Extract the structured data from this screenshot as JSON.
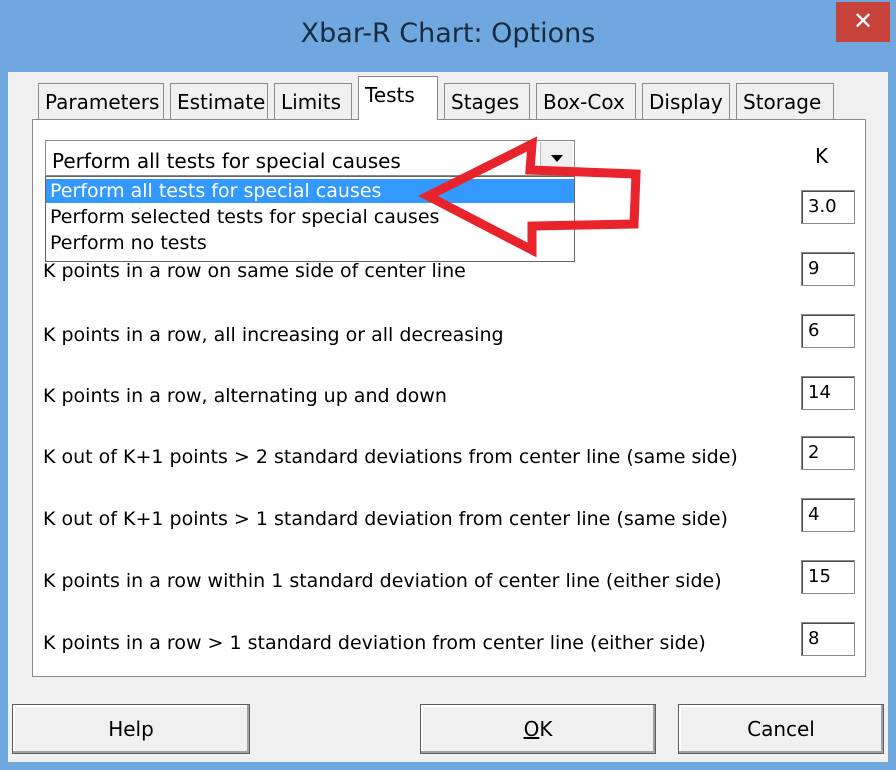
{
  "window": {
    "title": "Xbar-R Chart: Options",
    "close_glyph": "✕"
  },
  "tabs": [
    {
      "label": "Parameters",
      "active": false
    },
    {
      "label": "Estimate",
      "active": false
    },
    {
      "label": "Limits",
      "active": false
    },
    {
      "label": "Tests",
      "active": true
    },
    {
      "label": "Stages",
      "active": false
    },
    {
      "label": "Box-Cox",
      "active": false
    },
    {
      "label": "Display",
      "active": false
    },
    {
      "label": "Storage",
      "active": false
    }
  ],
  "tests": {
    "combo_value": "Perform all tests for special causes",
    "k_header": "K",
    "dropdown_options": [
      "Perform all tests for special causes",
      "Perform selected tests for special causes",
      "Perform no tests"
    ],
    "rows": [
      {
        "label": "",
        "k": "3.0"
      },
      {
        "label": "K points in a row on same side of center line",
        "k": "9"
      },
      {
        "label": "K points in a row, all increasing or all decreasing",
        "k": "6"
      },
      {
        "label": "K points in a row, alternating up and down",
        "k": "14"
      },
      {
        "label": "K out of K+1 points > 2 standard deviations from center line (same side)",
        "k": "2"
      },
      {
        "label": "K out of K+1 points > 1 standard deviation from center line (same side)",
        "k": "4"
      },
      {
        "label": "K points in a row within 1 standard deviation of center line (either side)",
        "k": "15"
      },
      {
        "label": "K points in a row > 1 standard deviation from center line (either side)",
        "k": "8"
      }
    ]
  },
  "buttons": {
    "help": "Help",
    "ok_mnemonic": "O",
    "ok_rest": "K",
    "cancel": "Cancel"
  },
  "annotation": {
    "arrow_color": "#e8232b"
  }
}
